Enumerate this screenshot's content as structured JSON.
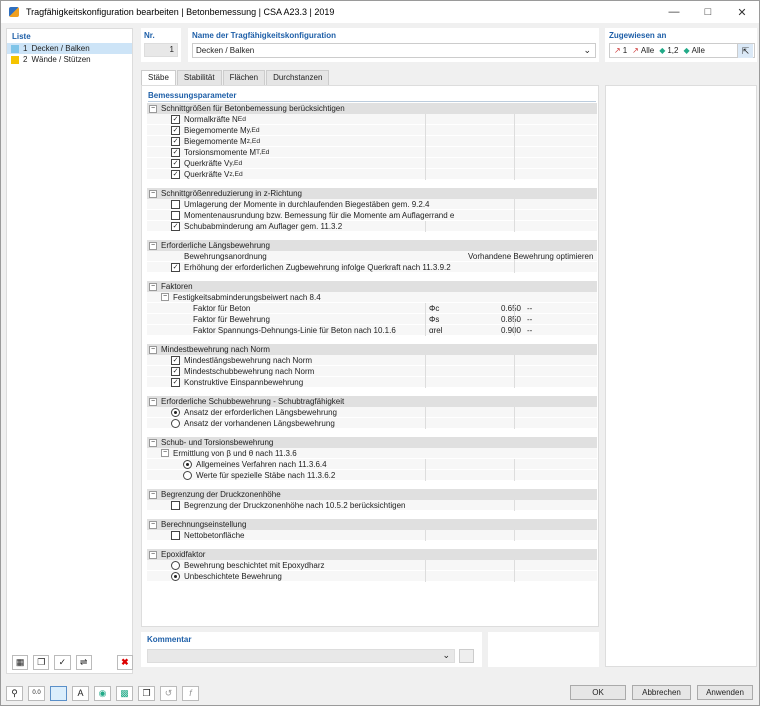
{
  "window": {
    "title": "Tragfähigkeitskonfiguration bearbeiten | Betonbemessung | CSA A23.3 | 2019"
  },
  "list": {
    "heading": "Liste",
    "items": [
      {
        "num": "1",
        "label": "Decken / Balken",
        "color": "#7fc4e8"
      },
      {
        "num": "2",
        "label": "Wände / Stützen",
        "color": "#f5c400"
      }
    ]
  },
  "nr": {
    "label": "Nr.",
    "value": "1"
  },
  "config_name": {
    "label": "Name der Tragfähigkeitskonfiguration",
    "value": "Decken / Balken"
  },
  "assigned": {
    "label": "Zugewiesen an",
    "items": [
      "1",
      "Alle",
      "1,2",
      "Alle"
    ]
  },
  "tabs": [
    "Stäbe",
    "Stabilität",
    "Flächen",
    "Durchstanzen"
  ],
  "params": {
    "title": "Bemessungsparameter",
    "s1": {
      "title": "Schnittgrößen für Betonbemessung berücksichtigen",
      "r1": "Normalkräfte N",
      "r1s": "Ed",
      "r2": "Biegemomente M",
      "r2s": "y,Ed",
      "r3": "Biegemomente M",
      "r3s": "z,Ed",
      "r4": "Torsionsmomente M",
      "r4s": "T,Ed",
      "r5": "Querkräfte V",
      "r5s": "y,Ed",
      "r6": "Querkräfte V",
      "r6s": "z,Ed"
    },
    "s2": {
      "title": "Schnittgrößenreduzierung in z-Richtung",
      "r1": "Umlagerung der Momente in durchlaufenden Biegestäben gem. 9.2.4",
      "r2": "Momentenausrundung bzw. Bemessung für die Momente am Auflagerrand e",
      "r3": "Schubabminderung am Auflager gem. 11.3.2"
    },
    "s3": {
      "title": "Erforderliche Längsbewehrung",
      "r1": "Bewehrungsanordnung",
      "r1v": "Vorhandene Bewehrung optimieren",
      "r2": "Erhöhung der erforderlichen Zugbewehrung infolge Querkraft nach 11.3.9.2"
    },
    "s4": {
      "title": "Faktoren",
      "sub": "Festigkeitsabminderungsbeiwert nach 8.4",
      "r1": "Faktor für Beton",
      "r1sym": "Φc",
      "r1v": "0.650",
      "r1u": "--",
      "r2": "Faktor für Bewehrung",
      "r2sym": "Φs",
      "r2v": "0.850",
      "r2u": "--",
      "r3": "Faktor Spannungs-Dehnungs-Linie für Beton nach 10.1.6",
      "r3sym": "αrel",
      "r3v": "0.900",
      "r3u": "--"
    },
    "s5": {
      "title": "Mindestbewehrung nach Norm",
      "r1": "Mindestlängsbewehrung nach Norm",
      "r2": "Mindestschubbewehrung nach Norm",
      "r3": "Konstruktive Einspannbewehrung"
    },
    "s6": {
      "title": "Erforderliche Schubbewehrung - Schubtragfähigkeit",
      "r1": "Ansatz der erforderlichen Längsbewehrung",
      "r2": "Ansatz der vorhandenen Längsbewehrung"
    },
    "s7": {
      "title": "Schub- und Torsionsbewehrung",
      "sub": "Ermittlung von β und θ nach 11.3.6",
      "r1": "Allgemeines Verfahren nach 11.3.6.4",
      "r2": "Werte für spezielle Stäbe nach 11.3.6.2"
    },
    "s8": {
      "title": "Begrenzung der Druckzonenhöhe",
      "r1": "Begrenzung der Druckzonenhöhe nach 10.5.2 berücksichtigen"
    },
    "s9": {
      "title": "Berechnungseinstellung",
      "r1": "Nettobetonfläche"
    },
    "s10": {
      "title": "Epoxidfaktor",
      "r1": "Bewehrung beschichtet mit Epoxydharz",
      "r2": "Unbeschichtete Bewehrung"
    }
  },
  "comment": {
    "label": "Kommentar"
  },
  "buttons": {
    "ok": "OK",
    "cancel": "Abbrechen",
    "apply": "Anwenden"
  },
  "colors": {
    "accent": "#1e5fa8",
    "selection": "#cde4f7"
  }
}
